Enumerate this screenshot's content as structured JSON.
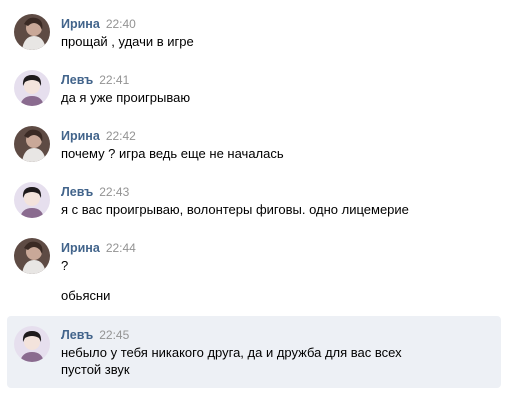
{
  "messages": [
    {
      "author": "Ирина",
      "time": "22:40",
      "lines": [
        "прощай , удачи в игре"
      ]
    },
    {
      "author": "Левъ",
      "time": "22:41",
      "lines": [
        "да я уже проигрываю"
      ]
    },
    {
      "author": "Ирина",
      "time": "22:42",
      "lines": [
        "почему ? игра ведь еще не началась"
      ]
    },
    {
      "author": "Левъ",
      "time": "22:43",
      "lines": [
        "я с вас проигрываю, волонтеры фиговы. одно лицемерие"
      ]
    },
    {
      "author": "Ирина",
      "time": "22:44",
      "lines": [
        "?",
        "обьясни"
      ]
    },
    {
      "author": "Левъ",
      "time": "22:45",
      "lines": [
        "небыло у тебя никакого друга, да и дружба для вас всех",
        "пустой звук"
      ]
    }
  ],
  "colors": {
    "author": "#42648b",
    "time": "#939393",
    "highlight": "#edf0f5"
  }
}
